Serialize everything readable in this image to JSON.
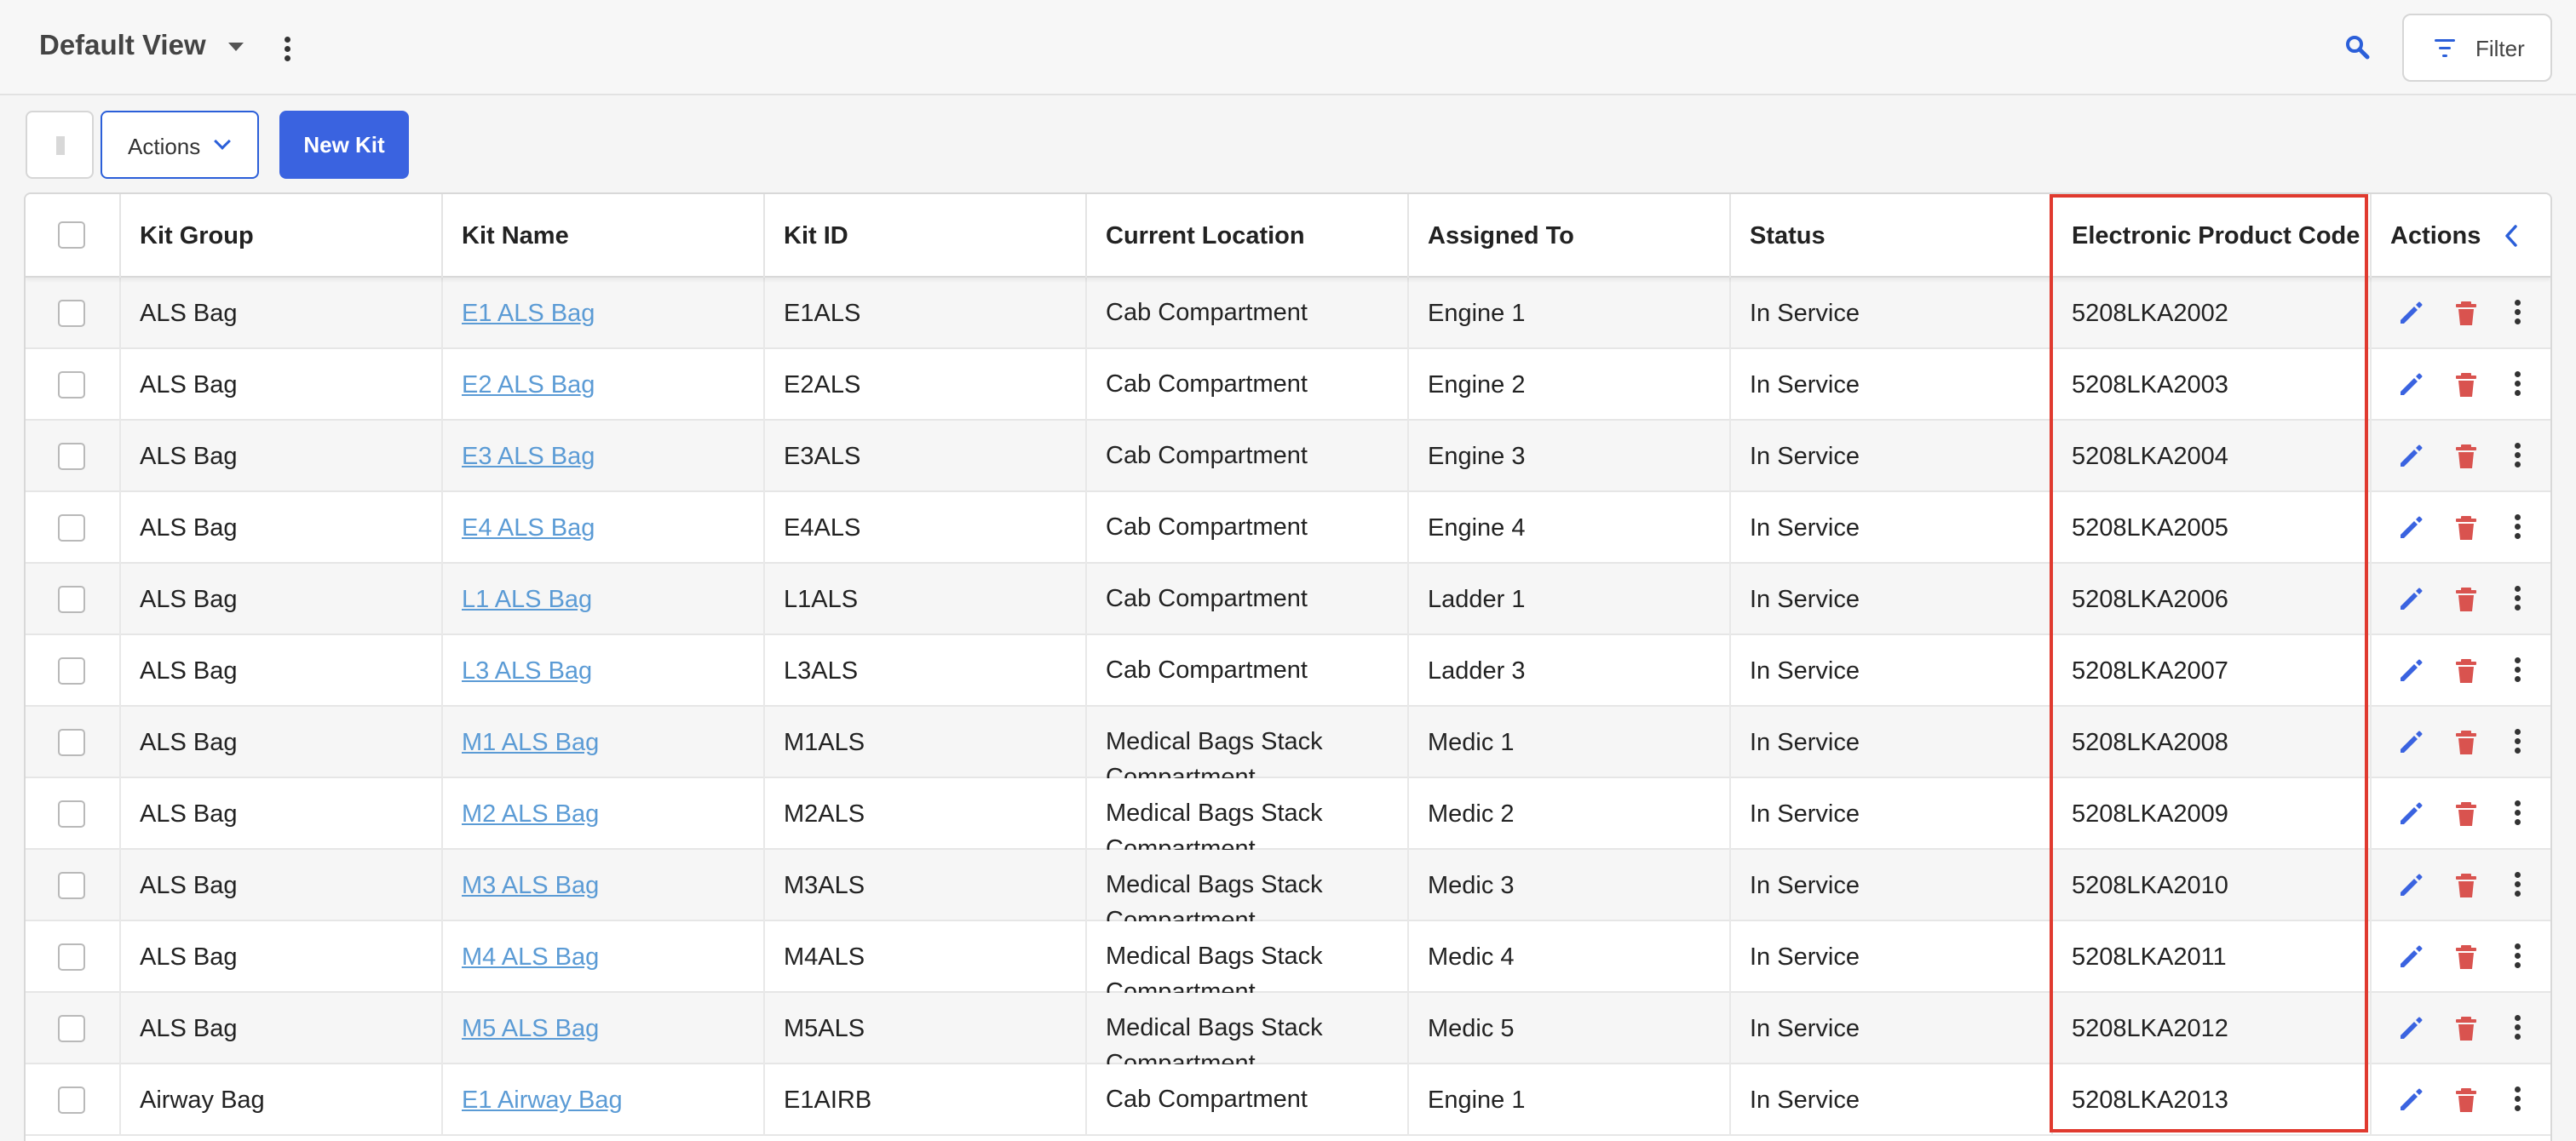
{
  "header": {
    "view_title": "Default View",
    "filter_label": "Filter"
  },
  "toolbar": {
    "actions_label": "Actions",
    "new_kit_label": "New Kit"
  },
  "table": {
    "columns": [
      "Kit Group",
      "Kit Name",
      "Kit ID",
      "Current Location",
      "Assigned To",
      "Status",
      "Electronic Product Code",
      "Actions"
    ],
    "rows": [
      {
        "group": "ALS Bag",
        "name": "E1 ALS Bag",
        "id": "E1ALS",
        "location": "Cab Compartment",
        "assigned": "Engine 1",
        "status": "In Service",
        "epc": "5208LKA2002"
      },
      {
        "group": "ALS Bag",
        "name": "E2 ALS Bag",
        "id": "E2ALS",
        "location": "Cab Compartment",
        "assigned": "Engine 2",
        "status": "In Service",
        "epc": "5208LKA2003"
      },
      {
        "group": "ALS Bag",
        "name": "E3 ALS Bag",
        "id": "E3ALS",
        "location": "Cab Compartment",
        "assigned": "Engine 3",
        "status": "In Service",
        "epc": "5208LKA2004"
      },
      {
        "group": "ALS Bag",
        "name": "E4 ALS Bag",
        "id": "E4ALS",
        "location": "Cab Compartment",
        "assigned": "Engine 4",
        "status": "In Service",
        "epc": "5208LKA2005"
      },
      {
        "group": "ALS Bag",
        "name": "L1 ALS Bag",
        "id": "L1ALS",
        "location": "Cab Compartment",
        "assigned": "Ladder 1",
        "status": "In Service",
        "epc": "5208LKA2006"
      },
      {
        "group": "ALS Bag",
        "name": "L3 ALS Bag",
        "id": "L3ALS",
        "location": "Cab Compartment",
        "assigned": "Ladder 3",
        "status": "In Service",
        "epc": "5208LKA2007"
      },
      {
        "group": "ALS Bag",
        "name": "M1 ALS Bag",
        "id": "M1ALS",
        "location": "Medical Bags Stack Compartment",
        "assigned": "Medic 1",
        "status": "In Service",
        "epc": "5208LKA2008"
      },
      {
        "group": "ALS Bag",
        "name": "M2 ALS Bag",
        "id": "M2ALS",
        "location": "Medical Bags Stack Compartment",
        "assigned": "Medic 2",
        "status": "In Service",
        "epc": "5208LKA2009"
      },
      {
        "group": "ALS Bag",
        "name": "M3 ALS Bag",
        "id": "M3ALS",
        "location": "Medical Bags Stack Compartment",
        "assigned": "Medic 3",
        "status": "In Service",
        "epc": "5208LKA2010"
      },
      {
        "group": "ALS Bag",
        "name": "M4 ALS Bag",
        "id": "M4ALS",
        "location": "Medical Bags Stack Compartment",
        "assigned": "Medic 4",
        "status": "In Service",
        "epc": "5208LKA2011"
      },
      {
        "group": "ALS Bag",
        "name": "M5 ALS Bag",
        "id": "M5ALS",
        "location": "Medical Bags Stack Compartment",
        "assigned": "Medic 5",
        "status": "In Service",
        "epc": "5208LKA2012"
      },
      {
        "group": "Airway Bag",
        "name": "E1 Airway Bag",
        "id": "E1AIRB",
        "location": "Cab Compartment",
        "assigned": "Engine 1",
        "status": "In Service",
        "epc": "5208LKA2013"
      }
    ]
  },
  "colors": {
    "accent": "#3a63e0",
    "delete": "#d9534f",
    "link": "#5b9bd5",
    "highlight": "#e03a2f"
  },
  "icons": [
    "caret-down-icon",
    "kebab-icon",
    "search-icon",
    "filter-icon",
    "chevron-down-icon",
    "chevron-left-icon",
    "pencil-icon",
    "trash-icon"
  ]
}
